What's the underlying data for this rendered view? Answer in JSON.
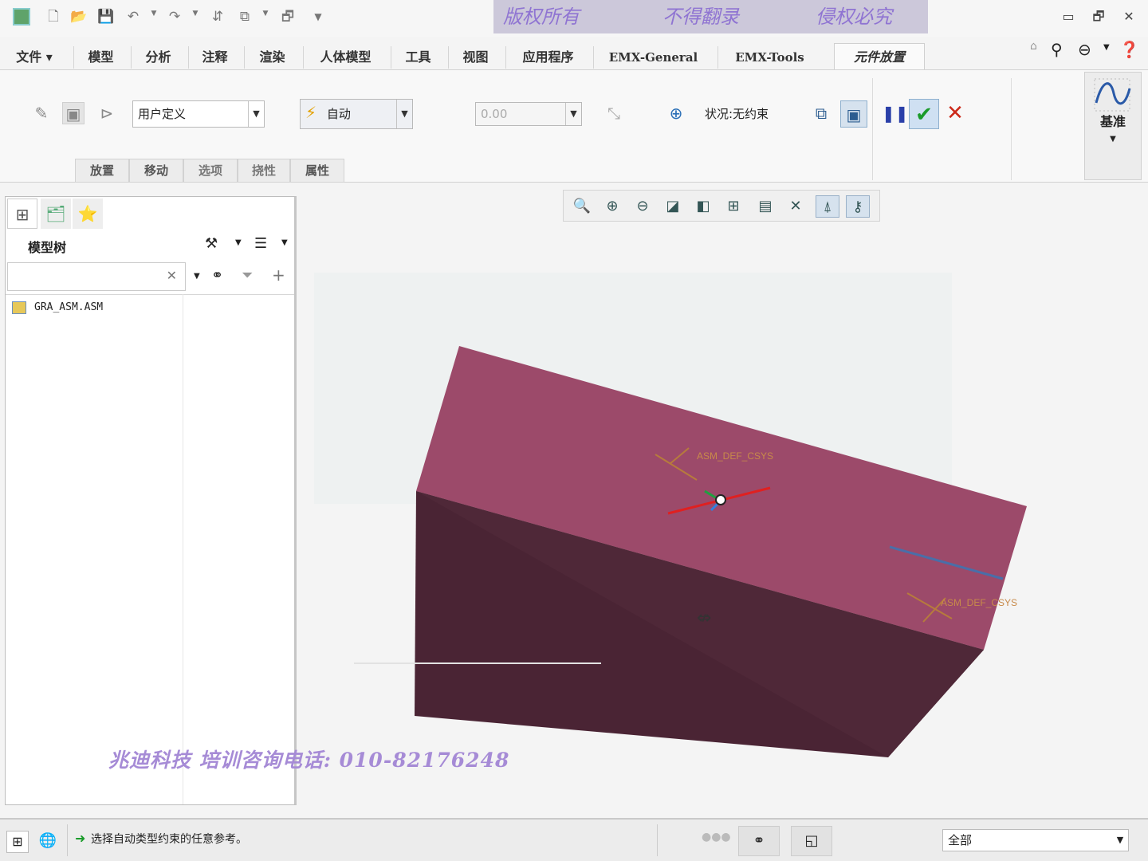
{
  "watermark": {
    "part1": "版权所有",
    "part2": "不得翻录",
    "part3": "侵权必究",
    "footer": "兆迪科技  培训咨询电话: 010-82176248"
  },
  "quick_access": {
    "icons": [
      "app-icon",
      "new-icon",
      "open-icon",
      "save-icon",
      "undo-icon",
      "redo-icon",
      "regenerate-icon",
      "windows-icon",
      "close-window-icon",
      "customize-icon"
    ]
  },
  "ribbon_tabs": [
    {
      "label": "文件"
    },
    {
      "label": "模型"
    },
    {
      "label": "分析"
    },
    {
      "label": "注释"
    },
    {
      "label": "渲染"
    },
    {
      "label": "人体模型"
    },
    {
      "label": "工具"
    },
    {
      "label": "视图"
    },
    {
      "label": "应用程序"
    },
    {
      "label": "EMX-General"
    },
    {
      "label": "EMX-Tools"
    },
    {
      "label": "元件放置"
    }
  ],
  "placement": {
    "constraint_set": "用户定义",
    "constraint_type": "自动",
    "offset_value": "0.00",
    "status": "状况:无约束"
  },
  "ribbon_buttons": {
    "placement": "放置",
    "move": "移动",
    "options": "选项",
    "flexibility": "挠性",
    "properties": "属性",
    "datum": "基准"
  },
  "model_tree": {
    "title": "模型树",
    "search_value": "",
    "root_item": "GRA_ASM.ASM"
  },
  "graphics": {
    "csys_top_label": "ASM_DEF_CSYS",
    "csys_bottom_label": "ASM_DEF_CSYS",
    "part_color": "#9c4a6a",
    "part_shadow_color": "#4a2434"
  },
  "status_bar": {
    "message": "选择自动类型约束的任意参考。",
    "filter": "全部"
  },
  "colors": {
    "accept": "#1a9b2a",
    "cancel": "#cc2a1a",
    "pause": "#2a3fa8",
    "watermark": "#8f74d2"
  }
}
